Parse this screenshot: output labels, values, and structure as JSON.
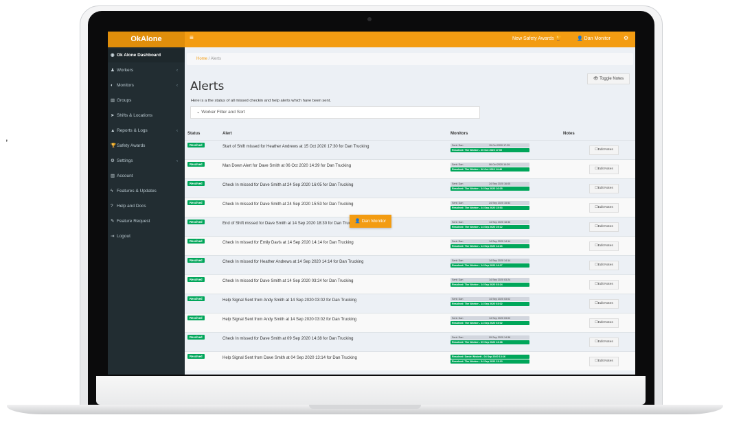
{
  "side_mark": ",",
  "app": {
    "brand": "OkAlone",
    "hamburger": "≡",
    "awards_link": "New Safety Awards 🏆",
    "user_link": "👤 Dan Monitor",
    "gear_glyph": "⚙"
  },
  "sidebar": {
    "items": [
      {
        "icon": "◉",
        "label": "Ok Alone Dashboard",
        "chevron": ""
      },
      {
        "icon": "♟",
        "label": "Workers",
        "chevron": "‹"
      },
      {
        "icon": "◐",
        "label": "Monitors",
        "chevron": "‹"
      },
      {
        "icon": "▥",
        "label": "Groups",
        "chevron": ""
      },
      {
        "icon": "➤",
        "label": "Shifts & Locations",
        "chevron": ""
      },
      {
        "icon": "▲",
        "label": "Reports & Logs",
        "chevron": "‹"
      },
      {
        "icon": "🏆",
        "label": "Safety Awards",
        "chevron": ""
      },
      {
        "icon": "⚙",
        "label": "Settings",
        "chevron": "‹"
      },
      {
        "icon": "▥",
        "label": "Account",
        "chevron": ""
      },
      {
        "icon": "ϟ",
        "label": "Features & Updates",
        "chevron": ""
      },
      {
        "icon": "?",
        "label": "Help and Docs",
        "chevron": ""
      },
      {
        "icon": "✎",
        "label": "Feature Request",
        "chevron": ""
      },
      {
        "icon": "⇥",
        "label": "Logout",
        "chevron": ""
      }
    ]
  },
  "breadcrumb": {
    "home": "Home",
    "separator": " / ",
    "current": "Alerts"
  },
  "toggle_notes": "👁 Toggle Notes",
  "page": {
    "title": "Alerts",
    "subtitle": "Here is a the status of all missed checkin and help alerts which have been sent.",
    "filter": "⌄ Worker Filter and Sort"
  },
  "table": {
    "headers": {
      "status": "Status",
      "alert": "Alert",
      "monitors": "Monitors",
      "notes": "Notes"
    },
    "edit_label": "☐Edit Notes",
    "rows": [
      {
        "status": "Resolved",
        "alert": "Start of Shift missed for Heather Andrews at 15 Oct 2020 17:30 for Dan Trucking",
        "sent": "Sent: Dan",
        "sent_date": "15 Oct 2020 17:35",
        "resolved": "Resolved: The Worker - 20 Oct 2020 17:00"
      },
      {
        "status": "Resolved",
        "alert": "Man Down Alert for Dave Smith at 06 Oct 2020 14:39 for Dan Trucking",
        "sent": "Sent: Dan",
        "sent_date": "06 Oct 2020 14:39",
        "resolved": "Resolved: The Worker - 06 Oct 2020 14:40"
      },
      {
        "status": "Resolved",
        "alert": "Check In missed for Dave Smith at 24 Sep 2020 16:05 for Dan Trucking",
        "sent": "Sent: Dan",
        "sent_date": "24 Sep 2020 16:05",
        "resolved": "Resolved: The Worker - 24 Sep 2020 16:05"
      },
      {
        "status": "Resolved",
        "alert": "Check In missed for Dave Smith at 24 Sep 2020 15:53 for Dan Trucking",
        "sent": "Sent: Dan",
        "sent_date": "24 Sep 2020 15:53",
        "resolved": "Resolved: The Worker - 24 Sep 2020 15:53"
      },
      {
        "status": "Resolved",
        "alert": "End of Shift missed for Dave Smith at 14 Sep 2020 18:30 for Dan Trucking",
        "sent": "Sent: Dan",
        "sent_date": "14 Sep 2020 18:36",
        "resolved": "Resolved: The Worker - 14 Sep 2020 19:12"
      },
      {
        "status": "Resolved",
        "alert": "Check In missed for Emily Davis at 14 Sep 2020 14:14 for Dan Trucking",
        "sent": "Sent: Dan",
        "sent_date": "14 Sep 2020 14:14",
        "resolved": "Resolved: The Worker - 14 Sep 2020 14:16"
      },
      {
        "status": "Resolved",
        "alert": "Check In missed for Heather Andrews at 14 Sep 2020 14:14 for Dan Trucking",
        "sent": "Sent: Dan",
        "sent_date": "14 Sep 2020 14:14",
        "resolved": "Resolved: The Worker - 14 Sep 2020 14:17"
      },
      {
        "status": "Resolved",
        "alert": "Check In missed for Dave Smith at 14 Sep 2020 03:24 for Dan Trucking",
        "sent": "Sent: Dan",
        "sent_date": "14 Sep 2020 03:24",
        "resolved": "Resolved: The Worker - 14 Sep 2020 03:24"
      },
      {
        "status": "Resolved",
        "alert": "Help Signal Sent from Andy Smith at 14 Sep 2020 03:02 for Dan Trucking",
        "sent": "Sent: Dan",
        "sent_date": "14 Sep 2020 03:02",
        "resolved": "Resolved: The Worker - 14 Sep 2020 03:02"
      },
      {
        "status": "Resolved",
        "alert": "Help Signal Sent from Andy Smith at 14 Sep 2020 03:02 for Dan Trucking",
        "sent": "Sent: Dan",
        "sent_date": "14 Sep 2020 03:02",
        "resolved": "Resolved: The Worker - 14 Sep 2020 03:02"
      },
      {
        "status": "Resolved",
        "alert": "Check In missed for Dave Smith at 09 Sep 2020 14:38 for Dan Trucking",
        "sent": "Sent: Dan",
        "sent_date": "09 Sep 2020 14:38",
        "resolved": "Resolved: The Worker - 09 Sep 2020 13:38"
      },
      {
        "status": "Resolved",
        "alert": "Help Signal Sent from Dave Smith at 04 Sep 2020 13:14 for Dan Trucking",
        "sent": "",
        "sent_date": "",
        "resolved_first": "Resolved: Daniel Nisbett - 04 Sep 2020 13:16",
        "resolved": "Resolved: The Worker - 04 Sep 2020 13:13"
      }
    ]
  },
  "tooltip": {
    "label": "👤 Dan Monitor"
  },
  "colors": {
    "topbar": "#f39c12",
    "sidebar": "#222d32",
    "resolved": "#00a65a",
    "content_bg": "#ecf0f5"
  }
}
